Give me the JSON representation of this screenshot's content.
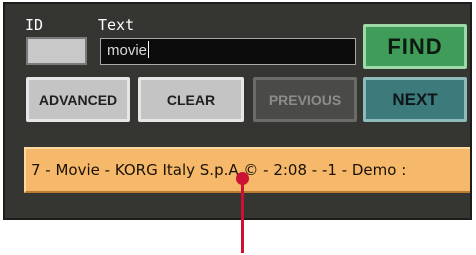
{
  "search": {
    "id_label": "ID",
    "text_label": "Text",
    "id_value": "",
    "text_value": "movie"
  },
  "buttons": {
    "find": "FIND",
    "advanced": "ADVANCED",
    "clear": "CLEAR",
    "previous": "PREVIOUS",
    "next": "NEXT"
  },
  "result": {
    "text": "7 - Movie - KORG Italy S.p.A © -  2:08 - -1 - Demo :"
  },
  "colors": {
    "panel": "#353532",
    "find_button": "#3f9c59",
    "next_button": "#3d7a7b",
    "result_highlight": "#f6b86a",
    "pointer": "#cc1233"
  }
}
